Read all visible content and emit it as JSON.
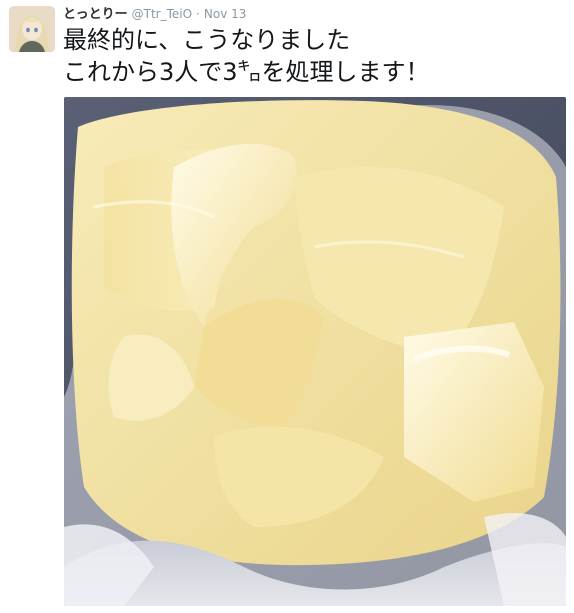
{
  "tweet": {
    "display_name": "とっとりー",
    "screen_name": "@Ttr_TeiO",
    "separator": "·",
    "timestamp": "Nov 13",
    "text": "最終的に、こうなりました\nこれから3人で3㌔を処理します！"
  },
  "icons": {
    "avatar": "user-avatar-anime-girl",
    "media": "butter-blocks-in-plastic-bag-photo"
  },
  "colors": {
    "name": "#292f33",
    "meta": "#8899a6",
    "text": "#14171a",
    "butter": "#f3e3a6"
  }
}
